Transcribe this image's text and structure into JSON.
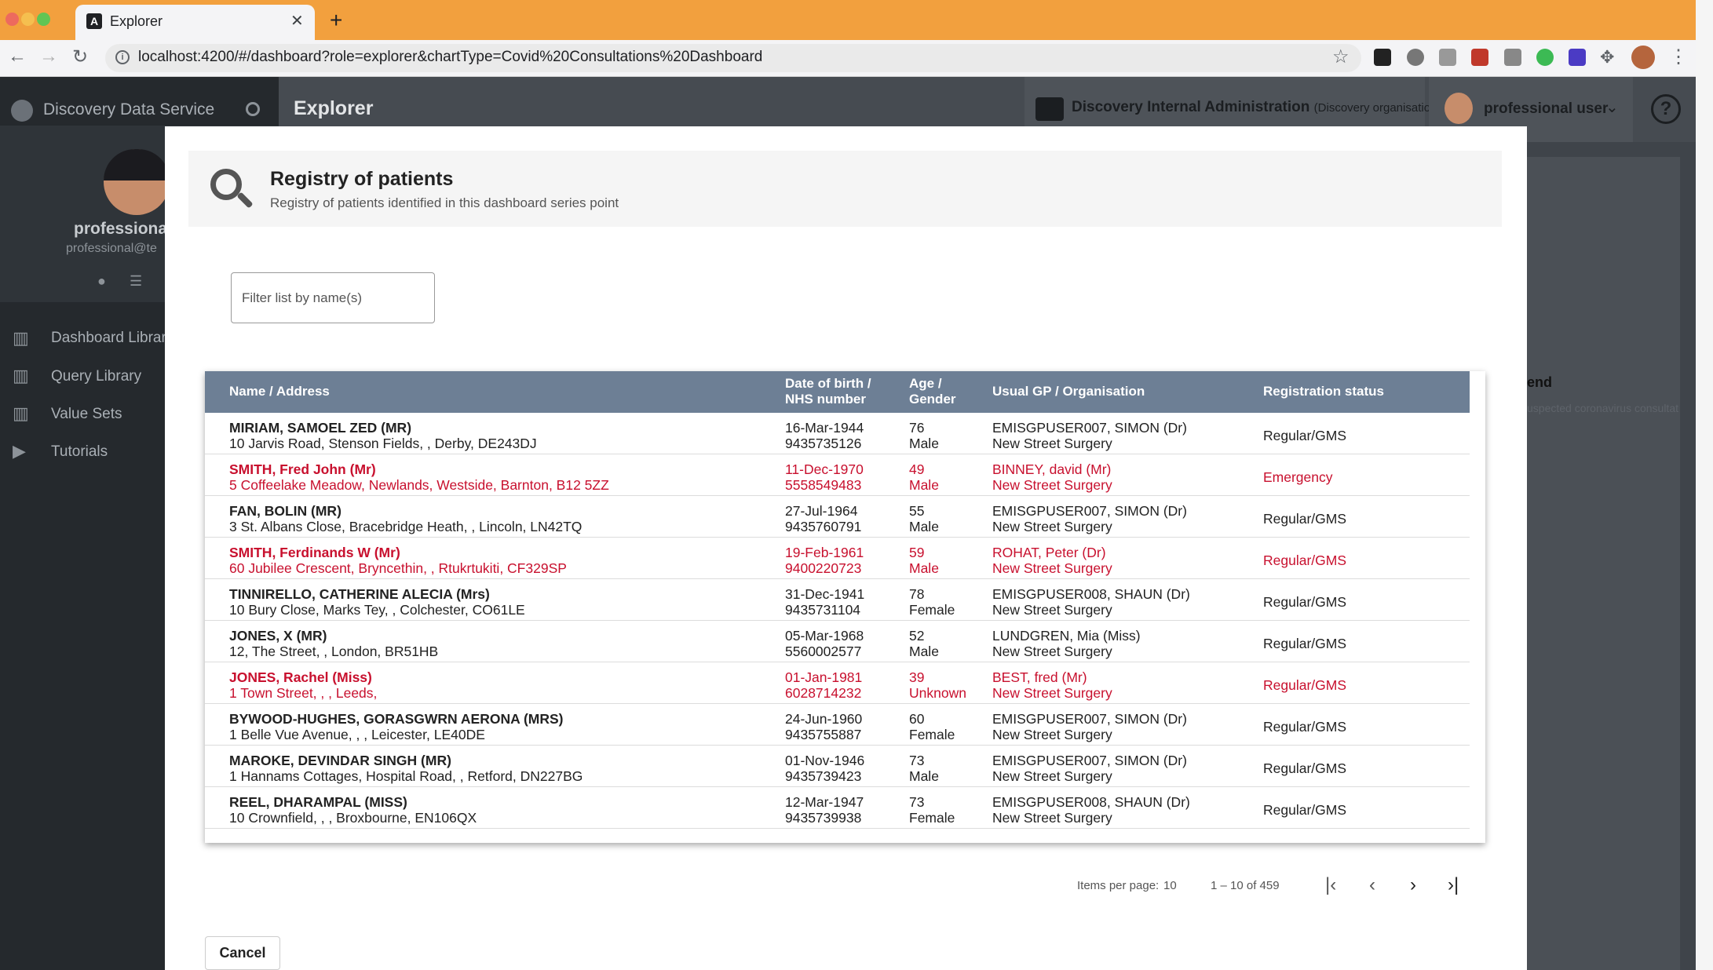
{
  "browser": {
    "tab_title": "Explorer",
    "url": "localhost:4200/#/dashboard?role=explorer&chartType=Covid%20Consultations%20Dashboard"
  },
  "app": {
    "brand": "Discovery Data Service",
    "page_title": "Explorer",
    "org_name": "Discovery Internal Administration",
    "org_sub": "(Discovery organisation)",
    "user_name": "professional user",
    "profile_name": "professional",
    "profile_email": "professional@te",
    "nav": [
      {
        "label": "Dashboard Library",
        "icon": "bar-chart-icon"
      },
      {
        "label": "Query Library",
        "icon": "bar-chart-icon"
      },
      {
        "label": "Value Sets",
        "icon": "bar-chart-icon"
      },
      {
        "label": "Tutorials",
        "icon": "video-camera-icon"
      }
    ],
    "background_legend": "end",
    "background_legend_sub": "uspected coronavirus consultat"
  },
  "modal": {
    "title": "Registry of patients",
    "subtitle": "Registry of patients identified in this dashboard series point",
    "filter_placeholder": "Filter list by name(s)",
    "headers": {
      "name": "Name / Address",
      "dob_1": "Date of birth /",
      "dob_2": "NHS number",
      "age_1": "Age /",
      "age_2": "Gender",
      "gp": "Usual GP / Organisation",
      "status": "Registration status"
    },
    "rows": [
      {
        "name": "MIRIAM, SAMOEL ZED (MR)",
        "address": "10 Jarvis Road, Stenson Fields, , Derby, DE243DJ",
        "dob": "16-Mar-1944",
        "nhs": "9435735126",
        "age": "76",
        "gender": "Male",
        "gp": "EMISGPUSER007, SIMON (Dr)",
        "org": "New Street Surgery",
        "status": "Regular/GMS",
        "highlight": false
      },
      {
        "name": "SMITH, Fred John (Mr)",
        "address": "5 Coffeelake Meadow, Newlands, Westside, Barnton, B12 5ZZ",
        "dob": "11-Dec-1970",
        "nhs": "5558549483",
        "age": "49",
        "gender": "Male",
        "gp": "BINNEY, david (Mr)",
        "org": "New Street Surgery",
        "status": "Emergency",
        "highlight": true
      },
      {
        "name": "FAN, BOLIN (MR)",
        "address": "3 St. Albans Close, Bracebridge Heath, , Lincoln, LN42TQ",
        "dob": "27-Jul-1964",
        "nhs": "9435760791",
        "age": "55",
        "gender": "Male",
        "gp": "EMISGPUSER007, SIMON (Dr)",
        "org": "New Street Surgery",
        "status": "Regular/GMS",
        "highlight": false
      },
      {
        "name": "SMITH, Ferdinands W (Mr)",
        "address": "60 Jubilee Crescent, Bryncethin, , Rtukrtukiti, CF329SP",
        "dob": "19-Feb-1961",
        "nhs": "9400220723",
        "age": "59",
        "gender": "Male",
        "gp": "ROHAT, Peter (Dr)",
        "org": "New Street Surgery",
        "status": "Regular/GMS",
        "highlight": true
      },
      {
        "name": "TINNIRELLO, CATHERINE ALECIA (Mrs)",
        "address": "10 Bury Close, Marks Tey, , Colchester, CO61LE",
        "dob": "31-Dec-1941",
        "nhs": "9435731104",
        "age": "78",
        "gender": "Female",
        "gp": "EMISGPUSER008, SHAUN (Dr)",
        "org": "New Street Surgery",
        "status": "Regular/GMS",
        "highlight": false
      },
      {
        "name": "JONES, X (MR)",
        "address": "12, The Street, , London, BR51HB",
        "dob": "05-Mar-1968",
        "nhs": "5560002577",
        "age": "52",
        "gender": "Male",
        "gp": "LUNDGREN, Mia (Miss)",
        "org": "New Street Surgery",
        "status": "Regular/GMS",
        "highlight": false
      },
      {
        "name": "JONES, Rachel (Miss)",
        "address": "1 Town Street, , , Leeds,",
        "dob": "01-Jan-1981",
        "nhs": "6028714232",
        "age": "39",
        "gender": "Unknown",
        "gp": "BEST, fred (Mr)",
        "org": "New Street Surgery",
        "status": "Regular/GMS",
        "highlight": true
      },
      {
        "name": "BYWOOD-HUGHES, GORASGWRN AERONA (MRS)",
        "address": "1 Belle Vue Avenue, , , Leicester, LE40DE",
        "dob": "24-Jun-1960",
        "nhs": "9435755887",
        "age": "60",
        "gender": "Female",
        "gp": "EMISGPUSER007, SIMON (Dr)",
        "org": "New Street Surgery",
        "status": "Regular/GMS",
        "highlight": false
      },
      {
        "name": "MAROKE, DEVINDAR SINGH (MR)",
        "address": "1 Hannams Cottages, Hospital Road, , Retford, DN227BG",
        "dob": "01-Nov-1946",
        "nhs": "9435739423",
        "age": "73",
        "gender": "Male",
        "gp": "EMISGPUSER007, SIMON (Dr)",
        "org": "New Street Surgery",
        "status": "Regular/GMS",
        "highlight": false
      },
      {
        "name": "REEL, DHARAMPAL (MISS)",
        "address": "10 Crownfield, , , Broxbourne, EN106QX",
        "dob": "12-Mar-1947",
        "nhs": "9435739938",
        "age": "73",
        "gender": "Female",
        "gp": "EMISGPUSER008, SHAUN (Dr)",
        "org": "New Street Surgery",
        "status": "Regular/GMS",
        "highlight": false
      }
    ],
    "paginator": {
      "items_per_page_label": "Items per page:",
      "items_per_page": "10",
      "range": "1 – 10 of 459"
    },
    "cancel_label": "Cancel"
  },
  "colors": {
    "highlight": "#c8102e",
    "header_bg": "#6d7f95",
    "tabbar": "#f2a03e"
  }
}
